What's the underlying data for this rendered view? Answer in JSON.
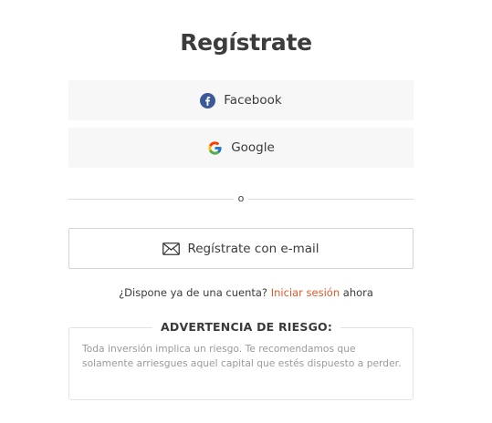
{
  "title": "Regístrate",
  "social": {
    "facebook_label": "Facebook",
    "google_label": "Google"
  },
  "divider": {
    "or_label": "o"
  },
  "email_button": {
    "label": "Regístrate con e-mail"
  },
  "login": {
    "prompt": "¿Dispone ya de una cuenta?",
    "link_label": "Iniciar sesión",
    "suffix": "ahora"
  },
  "risk_warning": {
    "title": "ADVERTENCIA DE RIESGO:",
    "text": "Toda inversión implica un riesgo. Te recomendamos que solamente arriesgues aquel capital que estés dispuesto a perder."
  },
  "colors": {
    "facebook_blue": "#3b5998",
    "link_orange": "#e2582a",
    "button_gray": "#f7f7f7"
  },
  "icons": {
    "facebook": "facebook-icon",
    "google": "google-icon",
    "email": "envelope-icon"
  }
}
